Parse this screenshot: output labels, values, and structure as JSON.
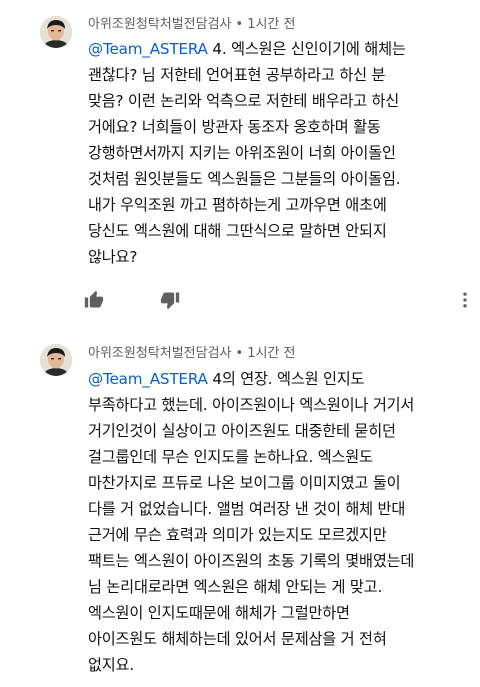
{
  "comments": [
    {
      "author": "아위조원청탁처벌전담검사",
      "separator": "•",
      "time": "1시간 전",
      "mention": "@Team_ASTERA",
      "first_line_rest": " 4. 엑스원은 신인이기에 해체는",
      "lines": [
        "괜찮다? 님 저한테 언어표현 공부하라고 하신 분",
        "맞음? 이런 논리와 억측으로 저한테 배우라고 하신",
        "거에요? 너희들이 방관자 동조자 옹호하며 활동",
        "강행하면서까지 지키는 아위조원이 너희 아이돌인",
        "것처럼 원잇분들도 엑스원들은 그분들의 아이돌임.",
        "내가 우익조원 까고 폄하하는게 고까우면 애초에",
        "당신도 엑스원에 대해 그딴식으로 말하면 안되지",
        "않나요?"
      ],
      "icons": [
        "thumbs-up-icon",
        "thumbs-down-icon",
        "more-vertical-icon"
      ]
    },
    {
      "author": "아위조원청탁처벌전담검사",
      "separator": "•",
      "time": "1시간 전",
      "mention": "@Team_ASTERA",
      "first_line_rest": " 4의 연장. 엑스원 인지도",
      "lines": [
        "부족하다고 했는데. 아이즈원이나 엑스원이나 거기서",
        "거기인것이 실상이고 아이즈원도 대중한테 묻히던",
        "걸그룹인데 무슨 인지도를 논하나요. 엑스원도",
        "마찬가지로 프듀로 나온 보이그룹 이미지였고 둘이",
        "다를 거 없었습니다. 앨범 여러장 낸 것이 해체 반대",
        "근거에 무슨 효력과 의미가 있는지도 모르겠지만",
        "팩트는 엑스원이 아이즈원의 초동 기록의 몇배였는데",
        "님 논리대로라면 엑스원은 해체 안되는 게 맞고.",
        "엑스원이 인지도때문에 해체가 그럴만하면",
        "아이즈원도 해체하는데 있어서 문제삼을 거 전혀",
        "없지요."
      ]
    }
  ],
  "colors": {
    "mention": "#065fd4",
    "meta": "#606060",
    "text": "#111111",
    "icon": "#606060"
  }
}
